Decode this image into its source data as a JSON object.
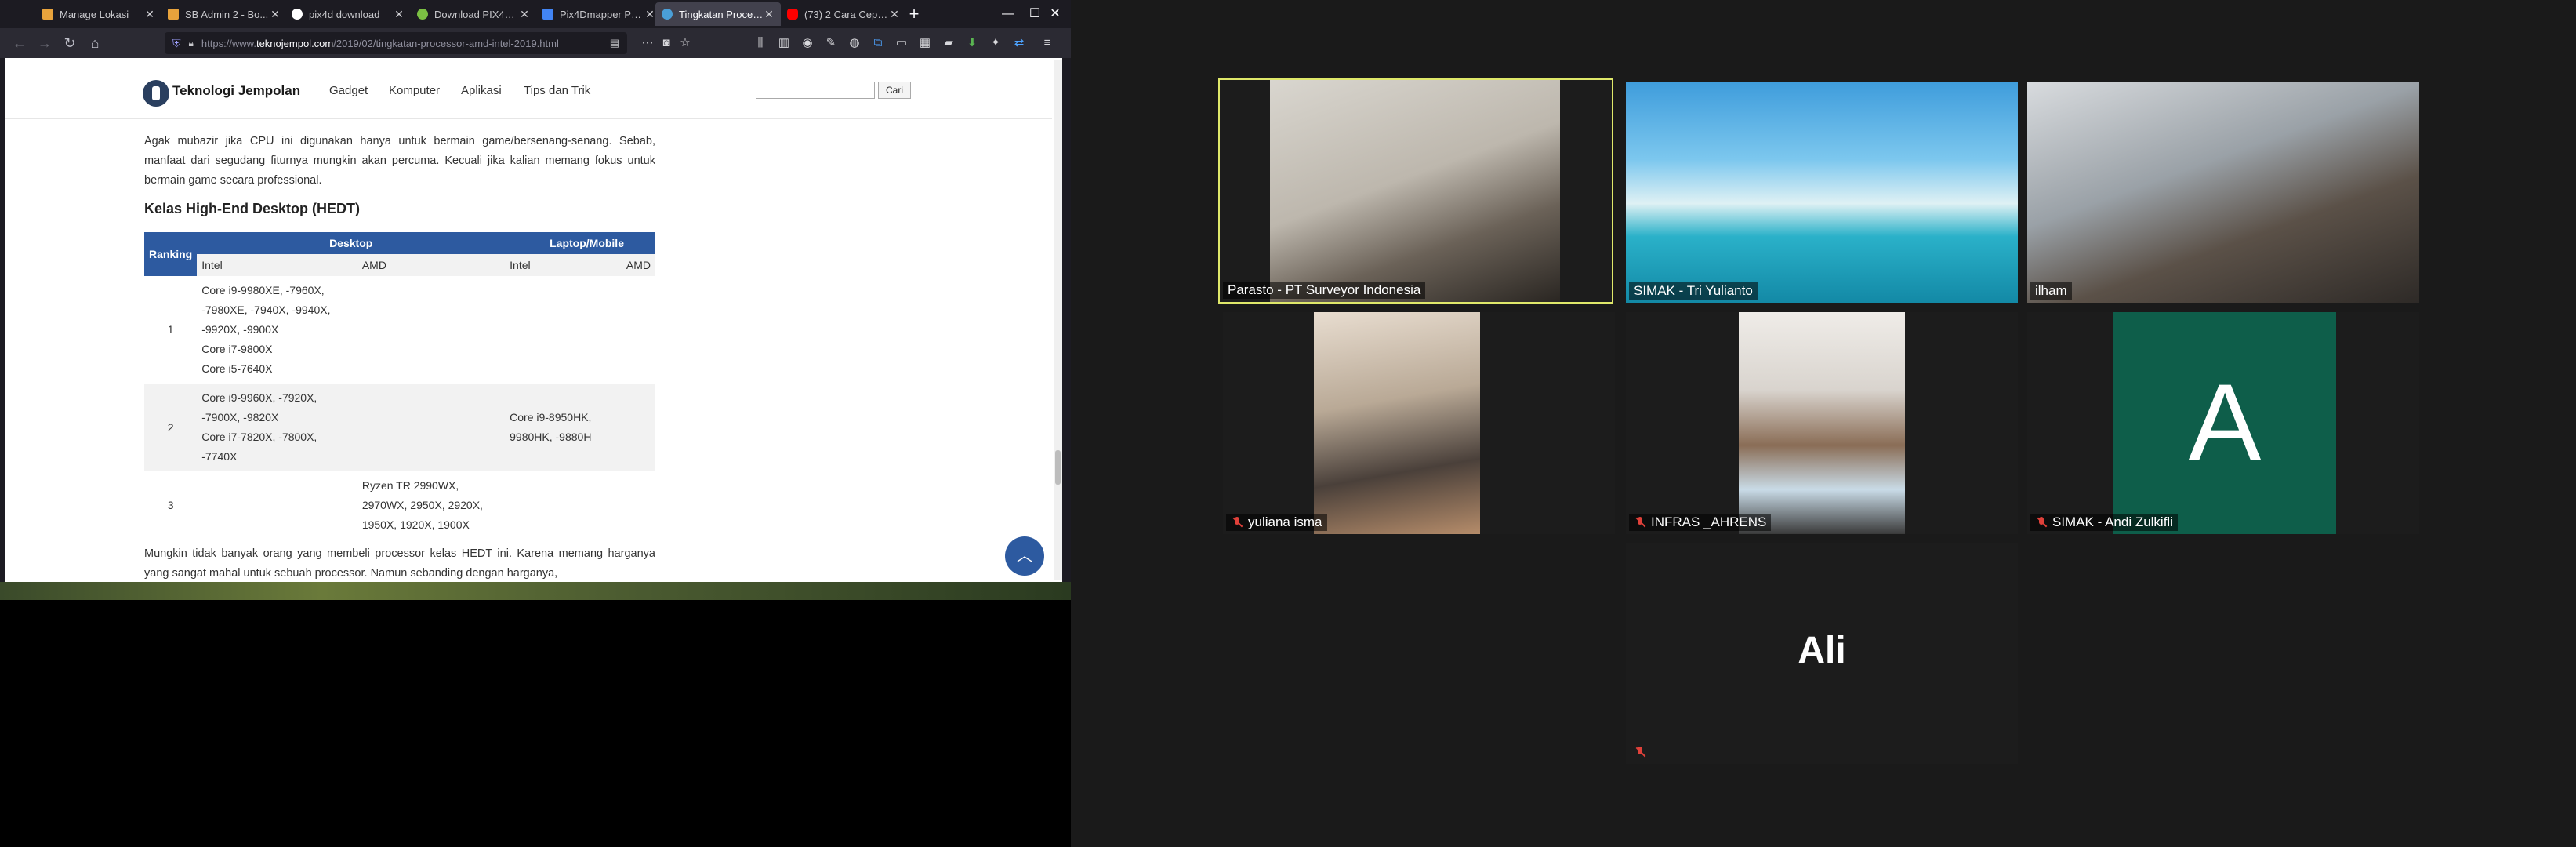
{
  "browser": {
    "tabs": [
      {
        "title": "Manage Lokasi",
        "favicon_color": "#e8a33c"
      },
      {
        "title": "SB Admin 2 - Bo...",
        "favicon_color": "#e8a33c"
      },
      {
        "title": "pix4d download",
        "favicon_color": "#ffffff"
      },
      {
        "title": "Download PIX4D...",
        "favicon_color": "#7bc043"
      },
      {
        "title": "Pix4Dmapper Pro...",
        "favicon_color": "#4285f4"
      },
      {
        "title": "Tingkatan Proces...",
        "favicon_color": "#4a9fd8"
      },
      {
        "title": "(73) 2 Cara Cepat...",
        "favicon_color": "#ff0000"
      }
    ],
    "close_glyph": "✕",
    "new_tab_glyph": "+",
    "window_controls": {
      "minimize": "—",
      "maximize": "☐",
      "close": "✕"
    },
    "url_prefix": "https://www.",
    "url_domain": "teknojempol.com",
    "url_path": "/2019/02/tingkatan-processor-amd-intel-2019.html",
    "toolbar_icons": [
      "library-icon",
      "sidebar-icon",
      "account-icon",
      "extension-icon",
      "download-icon"
    ]
  },
  "site": {
    "title": "Teknologi Jempolan",
    "menu": [
      "Gadget",
      "Komputer",
      "Aplikasi",
      "Tips dan Trik"
    ],
    "search_button": "Cari",
    "search_placeholder": ""
  },
  "article": {
    "intro": "Agak mubazir jika CPU ini digunakan hanya untuk bermain game/bersenang-senang. Sebab, manfaat dari segudang fiturnya mungkin akan percuma. Kecuali jika kalian memang fokus untuk bermain game secara professional.",
    "heading": "Kelas High-End Desktop (HEDT)",
    "table": {
      "rank_header": "Ranking",
      "group_headers": [
        "Desktop",
        "Laptop/Mobile"
      ],
      "sub_headers": [
        "Intel",
        "AMD",
        "Intel",
        "AMD"
      ],
      "rows": [
        {
          "rank": "1",
          "desktop_intel": [
            "Core i9-9980XE, -7960X,",
            "-7980XE, -7940X, -9940X,",
            "-9920X, -9900X",
            "Core i7-9800X",
            "Core i5-7640X"
          ],
          "desktop_amd": [],
          "mobile_intel": [],
          "mobile_amd": []
        },
        {
          "rank": "2",
          "desktop_intel": [
            "Core i9-9960X, -7920X,",
            "-7900X, -9820X",
            "Core i7-7820X, -7800X,",
            "-7740X"
          ],
          "desktop_amd": [],
          "mobile_intel": [
            "Core i9-8950HK,",
            "9980HK, -9880H"
          ],
          "mobile_amd": []
        },
        {
          "rank": "3",
          "desktop_intel": [],
          "desktop_amd": [
            "Ryzen TR 2990WX,",
            "2970WX, 2950X, 2920X,",
            "1950X, 1920X, 1900X"
          ],
          "mobile_intel": [],
          "mobile_amd": []
        }
      ]
    },
    "outro": "Mungkin tidak banyak orang yang membeli processor kelas HEDT ini. Karena memang harganya yang sangat mahal untuk sebuah processor. Namun sebanding dengan harganya,"
  },
  "zoom": {
    "participants": [
      {
        "name": "Parasto - PT Surveyor Indonesia",
        "muted": false,
        "active": true,
        "video": true
      },
      {
        "name": "SIMAK - Tri Yulianto",
        "muted": false,
        "active": false,
        "video": true
      },
      {
        "name": "ilham",
        "muted": false,
        "active": false,
        "video": true
      },
      {
        "name": "yuliana isma",
        "muted": true,
        "active": false,
        "video": true
      },
      {
        "name": "INFRAS _AHRENS",
        "muted": true,
        "active": false,
        "video": true
      },
      {
        "name": "SIMAK - Andi Zulkifli",
        "muted": true,
        "active": false,
        "video": false,
        "initial": "A",
        "avatar_color": "#0e5e4a"
      },
      {
        "name": "",
        "muted": true,
        "active": false,
        "video": false,
        "display_text": "Ali"
      }
    ]
  }
}
